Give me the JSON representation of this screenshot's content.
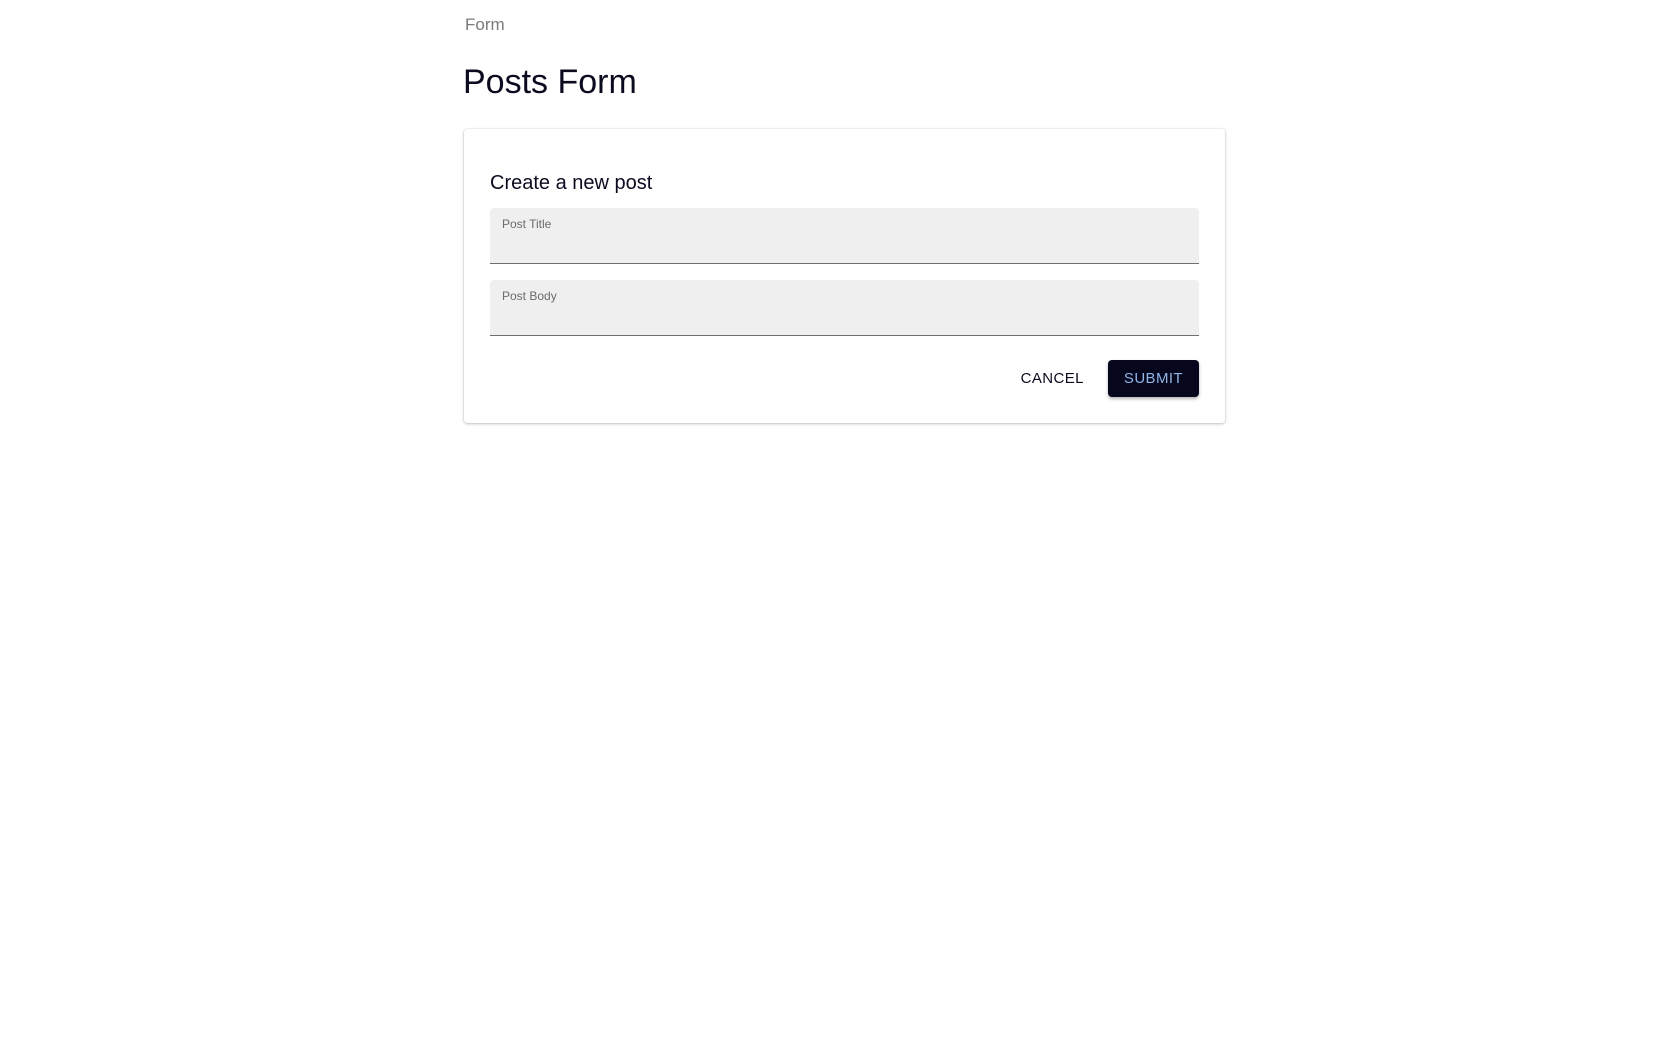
{
  "breadcrumb": {
    "label": "Form"
  },
  "page": {
    "title": "Posts Form"
  },
  "form": {
    "heading": "Create a new post",
    "fields": {
      "title": {
        "label": "Post Title",
        "value": ""
      },
      "body": {
        "label": "Post Body",
        "value": ""
      }
    },
    "actions": {
      "cancel_label": "CANCEL",
      "submit_label": "SUBMIT"
    }
  },
  "colors": {
    "submit_bg": "#06071d",
    "submit_text": "#8fb4e6",
    "field_bg": "#efefef"
  }
}
